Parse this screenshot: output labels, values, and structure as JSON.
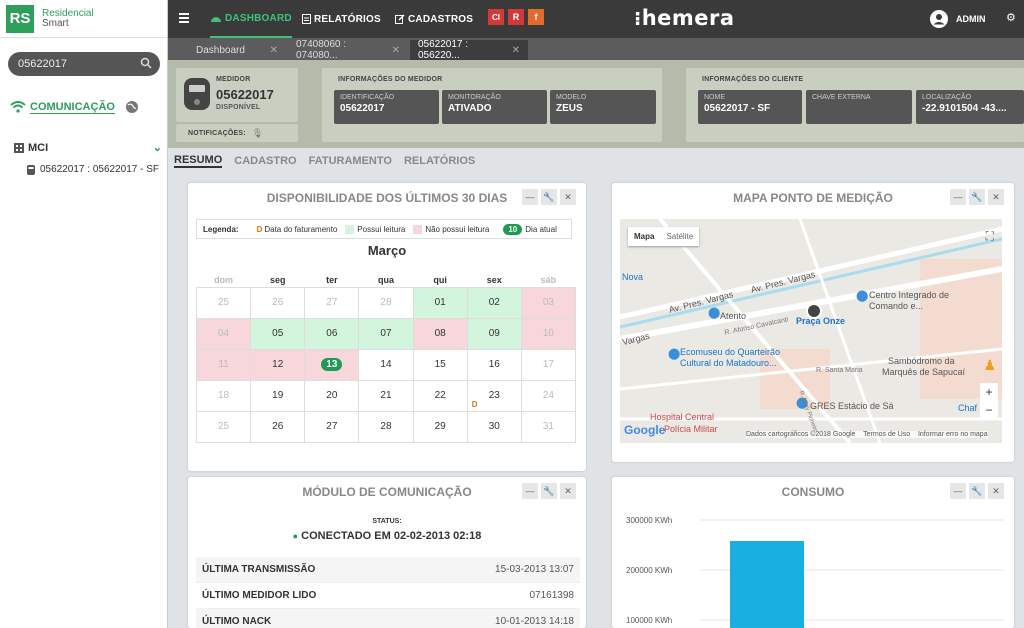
{
  "sidebar": {
    "logo_initials": "RS",
    "logo_line1": "Residencial",
    "logo_line2": "Smart",
    "search_value": "05622017",
    "comm_label": "COMUNICAÇÃO",
    "tree_root": "MCI",
    "tree_child": "05622017 : 05622017 - SF"
  },
  "topbar": {
    "nav": [
      "DASHBOARD",
      "RELATÓRIOS",
      "CADASTROS"
    ],
    "mini": [
      "CI",
      "R",
      "f"
    ],
    "brand": "hemera",
    "user": "ADMIN"
  },
  "tabs": [
    "Dashboard",
    "07408060 : 074080...",
    "05622017 : 056220..."
  ],
  "medidor": {
    "label": "MEDIDOR",
    "number": "05622017",
    "status": "DISPONÍVEL",
    "notif_label": "NOTIFICAÇÕES:"
  },
  "info_medidor": {
    "title": "INFORMAÇÕES DO MEDIDOR",
    "fields": [
      {
        "k": "IDENTIFICAÇÃO",
        "v": "05622017"
      },
      {
        "k": "MONITORAÇÃO",
        "v": "ATIVADO"
      },
      {
        "k": "MODELO",
        "v": "ZEUS"
      }
    ]
  },
  "info_cliente": {
    "title": "INFORMAÇÕES DO CLIENTE",
    "fields": [
      {
        "k": "NOME",
        "v": "05622017 - SF"
      },
      {
        "k": "CHAVE EXTERNA",
        "v": ""
      },
      {
        "k": "LOCALIZAÇÃO",
        "v": "-22.9101504 -43...."
      }
    ]
  },
  "subtabs": [
    "RESUMO",
    "CADASTRO",
    "FATURAMENTO",
    "RELATÓRIOS"
  ],
  "calendar": {
    "title": "DISPONIBILIDADE DOS ÚLTIMOS 30 DIAS",
    "legend_label": "Legenda:",
    "legend_billing": "Data do faturamento",
    "legend_read": "Possui leitura",
    "legend_noread": "Não possui leitura",
    "legend_today_num": "10",
    "legend_today": "Dia atual",
    "month": "Março",
    "days": [
      "dom",
      "seg",
      "ter",
      "qua",
      "qui",
      "sex",
      "sáb"
    ],
    "weeks": [
      [
        {
          "n": "25",
          "c": "f"
        },
        {
          "n": "26",
          "c": "f"
        },
        {
          "n": "27",
          "c": "f"
        },
        {
          "n": "28",
          "c": "f"
        },
        {
          "n": "01",
          "c": "g"
        },
        {
          "n": "02",
          "c": "g"
        },
        {
          "n": "03",
          "c": "rf"
        }
      ],
      [
        {
          "n": "04",
          "c": "rf"
        },
        {
          "n": "05",
          "c": "g"
        },
        {
          "n": "06",
          "c": "g"
        },
        {
          "n": "07",
          "c": "g"
        },
        {
          "n": "08",
          "c": "r"
        },
        {
          "n": "09",
          "c": "g"
        },
        {
          "n": "10",
          "c": "rf"
        }
      ],
      [
        {
          "n": "11",
          "c": "rf"
        },
        {
          "n": "12",
          "c": "r"
        },
        {
          "n": "13",
          "c": "t"
        },
        {
          "n": "14",
          "c": ""
        },
        {
          "n": "15",
          "c": ""
        },
        {
          "n": "16",
          "c": ""
        },
        {
          "n": "17",
          "c": "f"
        }
      ],
      [
        {
          "n": "18",
          "c": "f"
        },
        {
          "n": "19",
          "c": ""
        },
        {
          "n": "20",
          "c": ""
        },
        {
          "n": "21",
          "c": ""
        },
        {
          "n": "22",
          "c": ""
        },
        {
          "n": "23",
          "c": "d"
        },
        {
          "n": "24",
          "c": "f"
        }
      ],
      [
        {
          "n": "25",
          "c": "f"
        },
        {
          "n": "26",
          "c": ""
        },
        {
          "n": "27",
          "c": ""
        },
        {
          "n": "28",
          "c": ""
        },
        {
          "n": "29",
          "c": ""
        },
        {
          "n": "30",
          "c": ""
        },
        {
          "n": "31",
          "c": "f"
        }
      ]
    ],
    "billing_mark": "D"
  },
  "map": {
    "title": "MAPA PONTO DE MEDIÇÃO",
    "btn_map": "Mapa",
    "btn_sat": "Satélite",
    "labels": [
      "Av. Pres. Vargas",
      "Av. Pres. Vargas",
      "Vargas",
      "Nova",
      "Centro Integrado de Comando e...",
      "Atento",
      "Praça Onze",
      "R. Afonso Cavalcanti",
      "Ecomuseu do Quarteirão",
      "Cultural do Matadouro...",
      "Sambódromo da",
      "Marquês de Sapucaí",
      "R. Santa Maria",
      "GRES Estácio de Sá",
      "Hospital Central",
      "Polícia Militar",
      "Chaf",
      "R. Nery Pinheiro"
    ],
    "google": "Google",
    "footer": "Dados cartográficos ©2018 Google    Termos de Uso    Informar erro no mapa"
  },
  "module": {
    "title": "MÓDULO DE COMUNICAÇÃO",
    "status_label": "STATUS:",
    "status_value": "CONECTADO EM 02-02-2013 02:18",
    "rows": [
      {
        "k": "ÚLTIMA TRANSMISSÃO",
        "v": "15-03-2013 13:07"
      },
      {
        "k": "ÚLTIMO MEDIDOR LIDO",
        "v": "07161398"
      },
      {
        "k": "ÚLTIMO NACK",
        "v": "10-01-2013 14:18"
      }
    ]
  },
  "consumo": {
    "title": "CONSUMO",
    "chart_data": {
      "type": "bar",
      "categories": [
        ""
      ],
      "values": [
        258000
      ],
      "ylabel": "",
      "yticks": [
        "300000 KWh",
        "200000 KWh",
        "100000 KWh"
      ],
      "ylim": [
        0,
        300000
      ],
      "color": "#19aee0"
    }
  },
  "colors": {
    "accent": "#2e9e5b",
    "today": "#1f9a53",
    "bar": "#19aee0"
  }
}
